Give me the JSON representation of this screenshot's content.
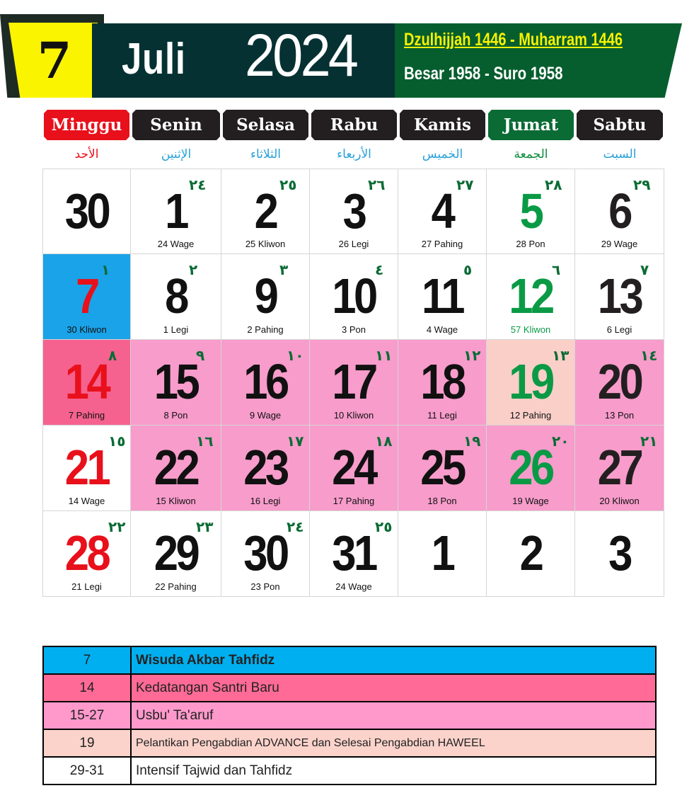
{
  "header": {
    "month_number": "7",
    "month_name": "Juli",
    "year": "2024",
    "hijri": "Dzulhijjah 1446 - Muharram 1446",
    "javanese": "Besar 1958 - Suro 1958"
  },
  "weekdays": [
    {
      "name": "Minggu",
      "arabic": "الأحد",
      "bg": "#e8101b",
      "ar_color": "#e8101b"
    },
    {
      "name": "Senin",
      "arabic": "الإثنين",
      "bg": "#231f20",
      "ar_color": "#26a0d8"
    },
    {
      "name": "Selasa",
      "arabic": "الثلاثاء",
      "bg": "#231f20",
      "ar_color": "#26a0d8"
    },
    {
      "name": "Rabu",
      "arabic": "الأربعاء",
      "bg": "#231f20",
      "ar_color": "#26a0d8"
    },
    {
      "name": "Kamis",
      "arabic": "الخميس",
      "bg": "#231f20",
      "ar_color": "#26a0d8"
    },
    {
      "name": "Jumat",
      "arabic": "الجمعة",
      "bg": "#0a6b34",
      "ar_color": "#0a8a3c"
    },
    {
      "name": "Sabtu",
      "arabic": "السبت",
      "bg": "#231f20",
      "ar_color": "#26a0d8"
    }
  ],
  "weeks": [
    [
      {
        "day": "30",
        "hijri": "",
        "pasar": "",
        "color": "#111",
        "bg": "#ffffff"
      },
      {
        "day": "1",
        "hijri": "٢٤",
        "pasar": "24 Wage",
        "color": "#111",
        "bg": "#ffffff"
      },
      {
        "day": "2",
        "hijri": "٢٥",
        "pasar": "25 Kliwon",
        "color": "#111",
        "bg": "#ffffff"
      },
      {
        "day": "3",
        "hijri": "٢٦",
        "pasar": "26 Legi",
        "color": "#111",
        "bg": "#ffffff"
      },
      {
        "day": "4",
        "hijri": "٢٧",
        "pasar": "27 Pahing",
        "color": "#111",
        "bg": "#ffffff"
      },
      {
        "day": "5",
        "hijri": "٢٨",
        "pasar": "28 Pon",
        "color": "#0a9a45",
        "bg": "#ffffff"
      },
      {
        "day": "6",
        "hijri": "٢٩",
        "pasar": "29 Wage",
        "color": "#231f20",
        "bg": "#ffffff"
      }
    ],
    [
      {
        "day": "7",
        "hijri": "١",
        "pasar": "30 Kliwon",
        "color": "#e8101b",
        "bg": "#1aa3e8"
      },
      {
        "day": "8",
        "hijri": "٢",
        "pasar": "1 Legi",
        "color": "#111",
        "bg": "#ffffff"
      },
      {
        "day": "9",
        "hijri": "٣",
        "pasar": "2 Pahing",
        "color": "#111",
        "bg": "#ffffff"
      },
      {
        "day": "10",
        "hijri": "٤",
        "pasar": "3 Pon",
        "color": "#111",
        "bg": "#ffffff"
      },
      {
        "day": "11",
        "hijri": "٥",
        "pasar": "4 Wage",
        "color": "#111",
        "bg": "#ffffff"
      },
      {
        "day": "12",
        "hijri": "٦",
        "pasar": "57 Kliwon",
        "color": "#0a9a45",
        "bg": "#ffffff"
      },
      {
        "day": "13",
        "hijri": "٧",
        "pasar": "6 Legi",
        "color": "#231f20",
        "bg": "#ffffff"
      }
    ],
    [
      {
        "day": "14",
        "hijri": "٨",
        "pasar": "7 Pahing",
        "color": "#e8101b",
        "bg": "#f6628f"
      },
      {
        "day": "15",
        "hijri": "٩",
        "pasar": "8 Pon",
        "color": "#111",
        "bg": "#f79ccb"
      },
      {
        "day": "16",
        "hijri": "١٠",
        "pasar": "9 Wage",
        "color": "#111",
        "bg": "#f79ccb"
      },
      {
        "day": "17",
        "hijri": "١١",
        "pasar": "10 Kliwon",
        "color": "#111",
        "bg": "#f79ccb"
      },
      {
        "day": "18",
        "hijri": "١٢",
        "pasar": "11 Legi",
        "color": "#111",
        "bg": "#f79ccb"
      },
      {
        "day": "19",
        "hijri": "١٣",
        "pasar": "12 Pahing",
        "color": "#0a9a45",
        "bg": "#f9cfc8"
      },
      {
        "day": "20",
        "hijri": "١٤",
        "pasar": "13 Pon",
        "color": "#231f20",
        "bg": "#f79ccb"
      }
    ],
    [
      {
        "day": "21",
        "hijri": "١٥",
        "pasar": "14 Wage",
        "color": "#e8101b",
        "bg": "#ffffff"
      },
      {
        "day": "22",
        "hijri": "١٦",
        "pasar": "15 Kliwon",
        "color": "#111",
        "bg": "#f79ccb"
      },
      {
        "day": "23",
        "hijri": "١٧",
        "pasar": "16 Legi",
        "color": "#111",
        "bg": "#f79ccb"
      },
      {
        "day": "24",
        "hijri": "١٨",
        "pasar": "17 Pahing",
        "color": "#111",
        "bg": "#f79ccb"
      },
      {
        "day": "25",
        "hijri": "١٩",
        "pasar": "18 Pon",
        "color": "#111",
        "bg": "#f79ccb"
      },
      {
        "day": "26",
        "hijri": "٢٠",
        "pasar": "19 Wage",
        "color": "#0a9a45",
        "bg": "#f79ccb"
      },
      {
        "day": "27",
        "hijri": "٢١",
        "pasar": "20 Kliwon",
        "color": "#231f20",
        "bg": "#f79ccb"
      }
    ],
    [
      {
        "day": "28",
        "hijri": "٢٢",
        "pasar": "21 Legi",
        "color": "#e8101b",
        "bg": "#ffffff"
      },
      {
        "day": "29",
        "hijri": "٢٣",
        "pasar": "22 Pahing",
        "color": "#111",
        "bg": "#ffffff"
      },
      {
        "day": "30",
        "hijri": "٢٤",
        "pasar": "23 Pon",
        "color": "#111",
        "bg": "#ffffff"
      },
      {
        "day": "31",
        "hijri": "٢٥",
        "pasar": "24 Wage",
        "color": "#111",
        "bg": "#ffffff"
      },
      {
        "day": "1",
        "hijri": "",
        "pasar": "",
        "color": "#111",
        "bg": "#ffffff"
      },
      {
        "day": "2",
        "hijri": "",
        "pasar": "",
        "color": "#111",
        "bg": "#ffffff"
      },
      {
        "day": "3",
        "hijri": "",
        "pasar": "",
        "color": "#111",
        "bg": "#ffffff"
      }
    ]
  ],
  "events": [
    {
      "date": "7",
      "text": "Wisuda Akbar Tahfidz",
      "bg": "#00aff0",
      "bold": true
    },
    {
      "date": "14",
      "text": "Kedatangan Santri Baru",
      "bg": "#ff6b96",
      "bold": false
    },
    {
      "date": "15-27",
      "text": "Usbu' Ta'aruf",
      "bg": "#ff99cc",
      "bold": false
    },
    {
      "date": "19",
      "text": "Pelantikan Pengabdian ADVANCE dan Selesai Pengabdian HAWEEL",
      "bg": "#fbd3cb",
      "bold": false,
      "small": true
    },
    {
      "date": "29-31",
      "text": "Intensif Tajwid dan Tahfidz",
      "bg": "#ffffff",
      "bold": false
    }
  ]
}
